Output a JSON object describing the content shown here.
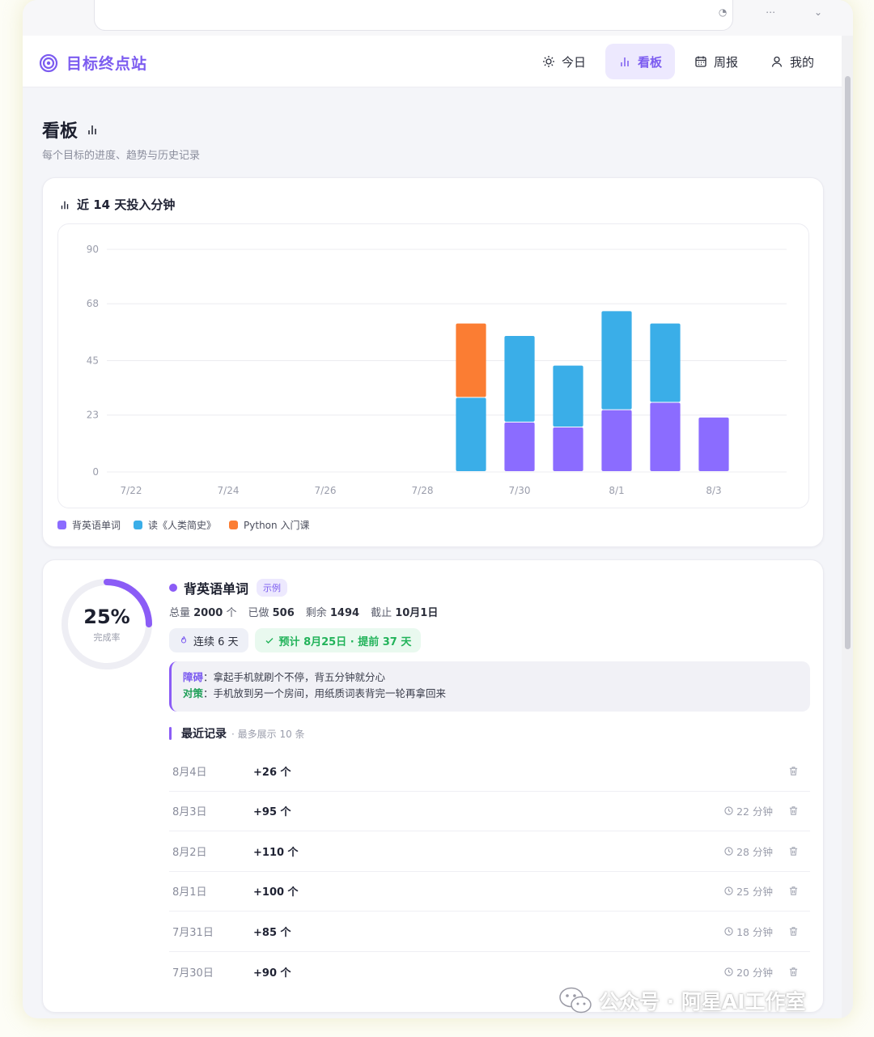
{
  "browser": {
    "url": ""
  },
  "brand": {
    "name": "目标终点站"
  },
  "nav": [
    {
      "label": "今日",
      "icon": "sun-icon"
    },
    {
      "label": "看板",
      "icon": "bar-chart-icon",
      "active": true
    },
    {
      "label": "周报",
      "icon": "calendar-icon"
    },
    {
      "label": "我的",
      "icon": "user-icon"
    }
  ],
  "page": {
    "title": "看板",
    "subtitle": "每个目标的进度、趋势与历史记录"
  },
  "chart_section": {
    "title": "近 14 天投入分钟"
  },
  "chart_data": {
    "type": "bar",
    "stacked": true,
    "title": "近 14 天投入分钟",
    "xlabel": "",
    "ylabel": "",
    "ylim": [
      0,
      90
    ],
    "yticks": [
      0,
      23,
      45,
      68,
      90
    ],
    "categories": [
      "7/22",
      "7/23",
      "7/24",
      "7/25",
      "7/26",
      "7/27",
      "7/28",
      "7/29",
      "7/30",
      "7/31",
      "8/1",
      "8/2",
      "8/3",
      "8/4"
    ],
    "xtick_labels": [
      "7/22",
      "7/24",
      "7/26",
      "7/28",
      "7/30",
      "8/1",
      "8/3"
    ],
    "series": [
      {
        "name": "背英语单词",
        "color": "#8b6cff",
        "values": [
          0,
          0,
          0,
          0,
          0,
          0,
          0,
          0,
          20,
          18,
          25,
          28,
          22,
          0
        ]
      },
      {
        "name": "读《人类简史》",
        "color": "#3aaee8",
        "values": [
          0,
          0,
          0,
          0,
          0,
          0,
          0,
          30,
          35,
          25,
          40,
          32,
          0,
          0
        ]
      },
      {
        "name": "Python 入门课",
        "color": "#fb7d33",
        "values": [
          0,
          0,
          0,
          0,
          0,
          0,
          0,
          30,
          0,
          0,
          0,
          0,
          0,
          0
        ]
      }
    ],
    "legend": "bottom-left",
    "grid": true
  },
  "goal": {
    "name": "背英语单词",
    "tag": "示例",
    "percent": "25%",
    "percent_label": "完成率",
    "progress": 0.25,
    "stats": [
      {
        "label": "总量",
        "value": "2000",
        "unit": "个"
      },
      {
        "label": "已做",
        "value": "506",
        "unit": ""
      },
      {
        "label": "剩余",
        "value": "1494",
        "unit": ""
      },
      {
        "label": "截止",
        "value": "10月1日",
        "unit": ""
      }
    ],
    "streak": "连续 6 天",
    "eta": "预计 8月25日 · 提前 37 天",
    "obstacle_key": "障碍",
    "obstacle_text": "拿起手机就刷个不停，背五分钟就分心",
    "strategy_key": "对策",
    "strategy_text": "手机放到另一个房间，用纸质词表背完一轮再拿回来",
    "records_title": "最近记录",
    "records_note": "· 最多展示 10 条",
    "records": [
      {
        "date": "8月4日",
        "amount": "+26 个",
        "time": ""
      },
      {
        "date": "8月3日",
        "amount": "+95 个",
        "time": "22 分钟"
      },
      {
        "date": "8月2日",
        "amount": "+110 个",
        "time": "28 分钟"
      },
      {
        "date": "8月1日",
        "amount": "+100 个",
        "time": "25 分钟"
      },
      {
        "date": "7月31日",
        "amount": "+85 个",
        "time": "18 分钟"
      },
      {
        "date": "7月30日",
        "amount": "+90 个",
        "time": "20 分钟"
      }
    ]
  },
  "watermark": {
    "text": "公众号 · 阿星AI工作室"
  }
}
